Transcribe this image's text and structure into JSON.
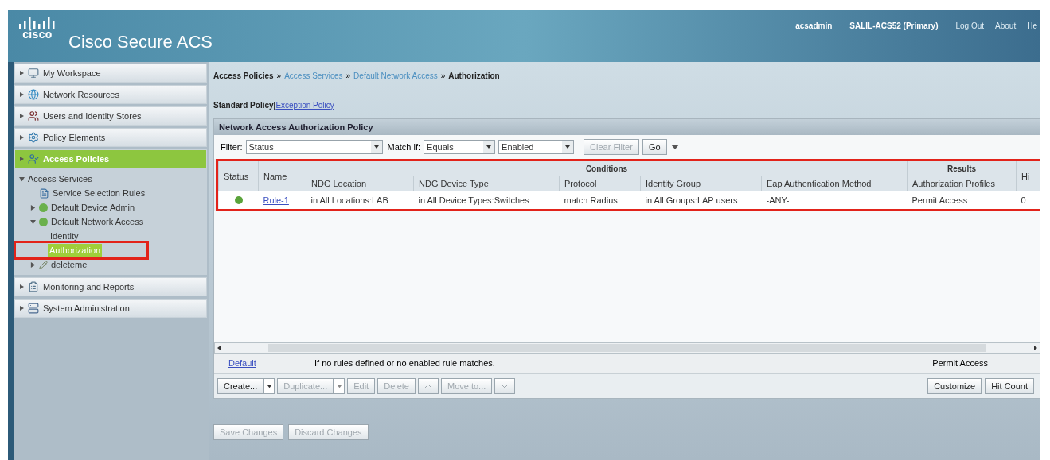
{
  "header": {
    "logo_text": "cisco",
    "product": "Cisco Secure ACS",
    "links": [
      {
        "text": "acsadmin",
        "kind": "text"
      },
      {
        "text": "SALIL-ACS52 (Primary)",
        "kind": "text"
      },
      {
        "text": "Log Out",
        "kind": "link"
      },
      {
        "text": "About",
        "kind": "link"
      },
      {
        "text": "He",
        "kind": "link"
      }
    ]
  },
  "sidebar": {
    "items": [
      {
        "label": "My Workspace",
        "selected": false
      },
      {
        "label": "Network Resources",
        "selected": false
      },
      {
        "label": "Users and Identity Stores",
        "selected": false
      },
      {
        "label": "Policy Elements",
        "selected": false
      },
      {
        "label": "Access Policies",
        "selected": true,
        "tree": [
          {
            "label": "Access Services",
            "expanded": true,
            "selected": false,
            "children": [
              {
                "label": "Service Selection Rules",
                "kind": "rules",
                "selected": false
              },
              {
                "label": "Default Device Admin",
                "kind": "service",
                "expanded": false,
                "selected": false
              },
              {
                "label": "Default Network Access",
                "kind": "service",
                "expanded": true,
                "selected": false,
                "children": [
                  {
                    "label": "Identity",
                    "selected": false,
                    "highlighted": false
                  },
                  {
                    "label": "Authorization",
                    "selected": true,
                    "highlighted": true
                  }
                ]
              },
              {
                "label": "deleteme",
                "kind": "custom",
                "expanded": false,
                "selected": false
              }
            ]
          }
        ]
      },
      {
        "label": "Monitoring and Reports",
        "selected": false
      },
      {
        "label": "System Administration",
        "selected": false
      }
    ]
  },
  "breadcrumb": [
    {
      "text": "Access Policies",
      "link": false
    },
    {
      "text": "Access Services",
      "link": true
    },
    {
      "text": "Default Network Access",
      "link": true
    },
    {
      "text": "Authorization",
      "link": false
    }
  ],
  "breadcrumb_separator": "»",
  "policy_tabs": {
    "separator": "|",
    "items": [
      {
        "label": "Standard Policy",
        "selected": true
      },
      {
        "label": "Exception Policy",
        "selected": false
      }
    ]
  },
  "panel": {
    "title": "Network Access Authorization Policy",
    "filter": {
      "label": "Filter:",
      "field": "Status",
      "match_label": "Match if:",
      "operator": "Equals",
      "value": "Enabled",
      "clear_button": {
        "label": "Clear Filter",
        "disabled": true
      },
      "go_button": {
        "label": "Go",
        "disabled": false
      }
    },
    "table": {
      "highlighted": true,
      "header_groups": [
        {
          "columns": [
            "Status",
            "Name"
          ]
        },
        {
          "label": "Conditions",
          "columns": [
            "NDG Location",
            "NDG Device Type",
            "Protocol",
            "Identity Group",
            "Eap Authentication Method"
          ]
        },
        {
          "label": "Results",
          "columns": [
            "Authorization Profiles"
          ]
        },
        {
          "columns": [
            "Hi"
          ]
        }
      ],
      "rows": [
        {
          "enabled": true,
          "name": "Rule-1",
          "cells": [
            "in All Locations:LAB",
            "in All Device Types:Switches",
            "match Radius",
            "in All Groups:LAP users",
            "-ANY-",
            "Permit Access",
            "0"
          ]
        }
      ]
    },
    "default_rule": {
      "name": "Default",
      "description": "If no rules defined or no enabled rule matches.",
      "result": "Permit Access"
    },
    "toolbar": [
      {
        "kind": "split",
        "label": "Create...",
        "disabled": false
      },
      {
        "kind": "split",
        "label": "Duplicate...",
        "disabled": true
      },
      {
        "kind": "plain",
        "label": "Edit",
        "disabled": true
      },
      {
        "kind": "plain",
        "label": "Delete",
        "disabled": true
      },
      {
        "kind": "up",
        "disabled": true
      },
      {
        "kind": "plain",
        "label": "Move to...",
        "disabled": true
      },
      {
        "kind": "down",
        "disabled": true
      }
    ],
    "right_buttons": [
      {
        "label": "Customize",
        "disabled": false
      },
      {
        "label": "Hit Count",
        "disabled": false
      }
    ]
  },
  "footer_buttons": [
    {
      "label": "Save Changes",
      "disabled": true
    },
    {
      "label": "Discard Changes",
      "disabled": true
    }
  ]
}
